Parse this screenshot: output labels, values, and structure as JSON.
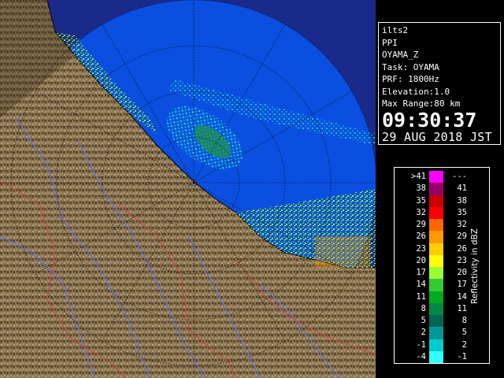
{
  "info_panel": {
    "product": "ilts2",
    "mode": "PPI",
    "variable": "OYAMA_Z",
    "task": "Task: OYAMA",
    "prf": "PRF: 1800Hz",
    "elevation": "Elevation:1.0",
    "max_range": "Max Range:80 km",
    "time": "09:30:37",
    "date": "29 AUG 2018 JST"
  },
  "legend": {
    "title": "Reflectivity in dBZ",
    "rows": [
      {
        "lo": ">41",
        "hi": "---",
        "color": "#ff00ff"
      },
      {
        "lo": "38",
        "hi": "41",
        "color": "#990066"
      },
      {
        "lo": "35",
        "hi": "38",
        "color": "#cc0000"
      },
      {
        "lo": "32",
        "hi": "35",
        "color": "#ff0000"
      },
      {
        "lo": "29",
        "hi": "32",
        "color": "#ff6600"
      },
      {
        "lo": "26",
        "hi": "29",
        "color": "#ff9900"
      },
      {
        "lo": "23",
        "hi": "26",
        "color": "#ffcc00"
      },
      {
        "lo": "20",
        "hi": "23",
        "color": "#ffff00"
      },
      {
        "lo": "17",
        "hi": "20",
        "color": "#99ff33"
      },
      {
        "lo": "14",
        "hi": "17",
        "color": "#33cc33"
      },
      {
        "lo": "11",
        "hi": "14",
        "color": "#00aa22"
      },
      {
        "lo": "8",
        "hi": "11",
        "color": "#008844"
      },
      {
        "lo": "5",
        "hi": "8",
        "color": "#006655"
      },
      {
        "lo": "2",
        "hi": "5",
        "color": "#009999"
      },
      {
        "lo": "-1",
        "hi": "2",
        "color": "#00cccc"
      },
      {
        "lo": "-4",
        "hi": "-1",
        "color": "#33ffff"
      }
    ]
  }
}
